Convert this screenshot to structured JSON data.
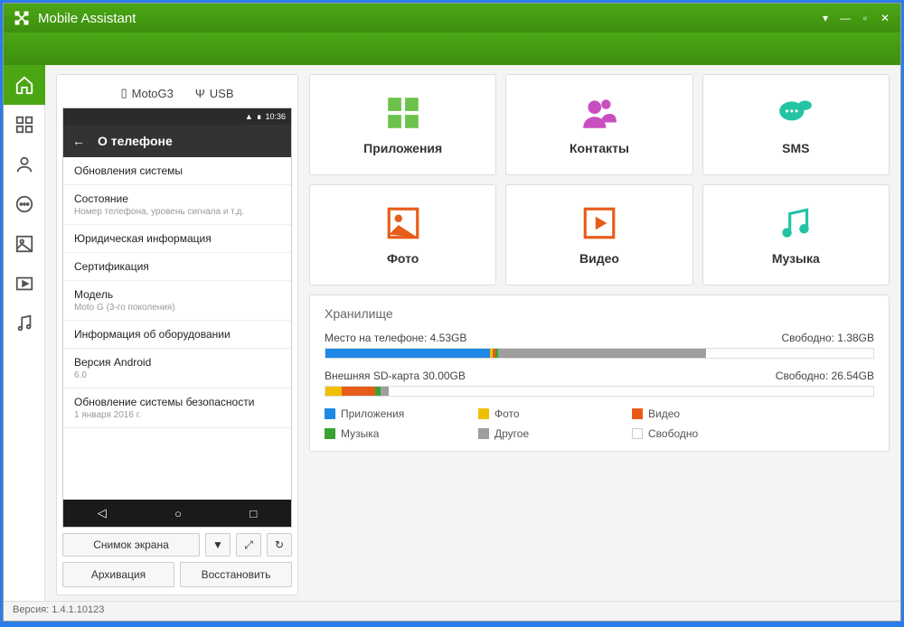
{
  "app": {
    "title": "Mobile Assistant"
  },
  "device": {
    "name": "MotoG3",
    "connection": "USB",
    "status_time": "10:36"
  },
  "phone_screen": {
    "title": "О телефоне",
    "rows": [
      {
        "primary": "Обновления системы",
        "secondary": ""
      },
      {
        "primary": "Состояние",
        "secondary": "Номер телефона, уровень сигнала и т.д."
      },
      {
        "primary": "Юридическая информация",
        "secondary": ""
      },
      {
        "primary": "Сертификация",
        "secondary": ""
      },
      {
        "primary": "Модель",
        "secondary": "Moto G (3-го поколения)"
      },
      {
        "primary": "Информация об оборудовании",
        "secondary": ""
      },
      {
        "primary": "Версия Android",
        "secondary": "6.0"
      },
      {
        "primary": "Обновление системы безопасности",
        "secondary": "1 января 2016 г."
      }
    ]
  },
  "phone_controls": {
    "screenshot": "Снимок экрана",
    "archive": "Архивация",
    "restore": "Восстановить"
  },
  "tiles": {
    "apps": "Приложения",
    "contacts": "Контакты",
    "sms": "SMS",
    "photo": "Фото",
    "video": "Видео",
    "music": "Музыка"
  },
  "storage": {
    "title": "Хранилище",
    "phone_label": "Место на телефоне: 4.53GB",
    "phone_free": "Свободно: 1.38GB",
    "sd_label": "Внешняя SD-карта 30.00GB",
    "sd_free": "Свободно: 26.54GB",
    "legend": {
      "apps": "Приложения",
      "photo": "Фото",
      "video": "Видео",
      "music": "Музыка",
      "other": "Другое",
      "free": "Свободно"
    }
  },
  "colors": {
    "apps": "#1f87e5",
    "photo": "#f0c000",
    "video": "#e85c1a",
    "music": "#3aa233",
    "other": "#9e9e9e",
    "free": "#ffffff"
  },
  "footer": {
    "version_label": "Версия: 1.4.1.10123"
  },
  "chart_data": [
    {
      "type": "bar",
      "title": "Место на телефоне",
      "total_gb": 4.53,
      "free_gb": 1.38,
      "segments": [
        {
          "name": "Приложения",
          "pct": 30
        },
        {
          "name": "Фото",
          "pct": 0.5
        },
        {
          "name": "Видео",
          "pct": 0.5
        },
        {
          "name": "Музыка",
          "pct": 0.5
        },
        {
          "name": "Другое",
          "pct": 38
        },
        {
          "name": "Свободно",
          "pct": 30.5
        }
      ]
    },
    {
      "type": "bar",
      "title": "Внешняя SD-карта",
      "total_gb": 30.0,
      "free_gb": 26.54,
      "segments": [
        {
          "name": "Приложения",
          "pct": 0
        },
        {
          "name": "Фото",
          "pct": 3
        },
        {
          "name": "Видео",
          "pct": 6
        },
        {
          "name": "Музыка",
          "pct": 1
        },
        {
          "name": "Другое",
          "pct": 1.5
        },
        {
          "name": "Свободно",
          "pct": 88.5
        }
      ]
    }
  ]
}
